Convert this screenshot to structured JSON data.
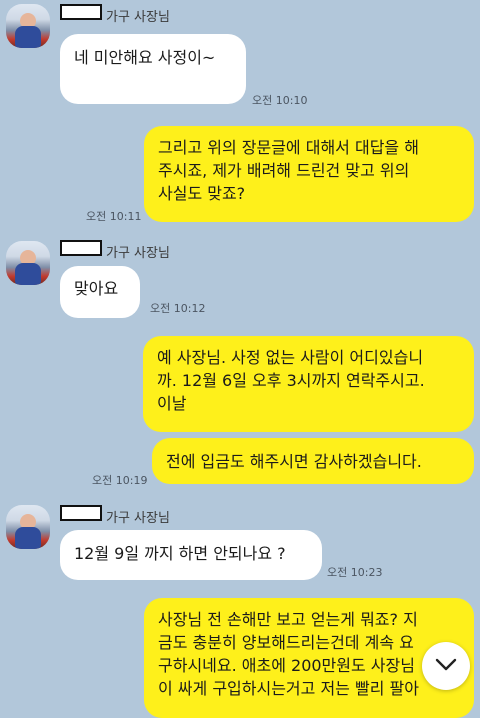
{
  "messages": [
    {
      "sender": "가구 사장님",
      "text": "네 미안해요 사정이~",
      "time": "오전 10:10"
    },
    {
      "text": "그리고 위의 장문글에 대해서 대답을 해\n주시죠, 제가 배려해 드린건 맞고 위의\n사실도 맞죠?",
      "time": "오전 10:11"
    },
    {
      "sender": "가구 사장님",
      "text": "맞아요",
      "time": "오전 10:12"
    },
    {
      "text": "예 사장님. 사정 없는 사람이 어디있습니\n까. 12월 6일 오후 3시까지 연락주시고.\n이날"
    },
    {
      "text": "전에 입금도 해주시면 감사하겠습니다.",
      "time": "오전 10:19"
    },
    {
      "sender": "가구 사장님",
      "text": "12월 9일 까지 하면 안되나요 ?",
      "time": "오전 10:23"
    },
    {
      "text": "사장님 전 손해만 보고 얻는게 뭐죠? 지\n금도 충분히 양보해드리는건데 계속 요\n구하시네요. 애초에 200만원도 사장님\n이 싸게 구입하시는거고 저는 빨리 팔아"
    }
  ],
  "icons": {
    "scroll_down": "chevron-down-icon",
    "avatar": "avatar"
  },
  "colors": {
    "background": "#b2c7da",
    "my_bubble": "#fef01b",
    "their_bubble": "#ffffff"
  }
}
